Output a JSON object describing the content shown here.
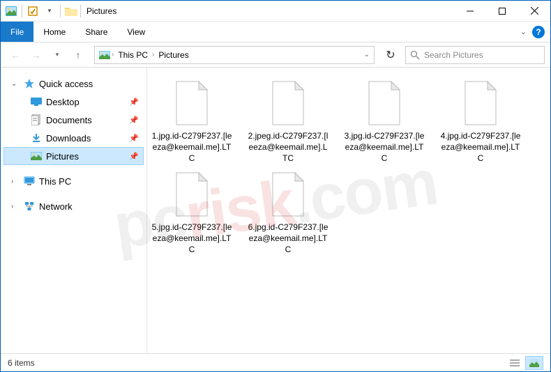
{
  "titlebar": {
    "title": "Pictures"
  },
  "ribbon": {
    "file": "File",
    "tabs": [
      "Home",
      "Share",
      "View"
    ]
  },
  "nav": {
    "crumbs": [
      "This PC",
      "Pictures"
    ],
    "search_placeholder": "Search Pictures"
  },
  "sidebar": {
    "quick_access": "Quick access",
    "items": [
      {
        "label": "Desktop",
        "icon": "desktop",
        "pinned": true
      },
      {
        "label": "Documents",
        "icon": "documents",
        "pinned": true
      },
      {
        "label": "Downloads",
        "icon": "downloads",
        "pinned": true
      },
      {
        "label": "Pictures",
        "icon": "pictures",
        "pinned": true,
        "selected": true
      }
    ],
    "this_pc": "This PC",
    "network": "Network"
  },
  "files": [
    "1.jpg.id-C279F237.[leeza@keemail.me].LTC",
    "2.jpeg.id-C279F237.[leeza@keemail.me].LTC",
    "3.jpg.id-C279F237.[leeza@keemail.me].LTC",
    "4.jpg.id-C279F237.[leeza@keemail.me].LTC",
    "5.jpg.id-C279F237.[leeza@keemail.me].LTC",
    "6.jpg.id-C279F237.[leeza@keemail.me].LTC"
  ],
  "status": {
    "count": "6 items"
  },
  "watermark": {
    "p1": "pc",
    "p2": "risk",
    "p3": ".com"
  }
}
